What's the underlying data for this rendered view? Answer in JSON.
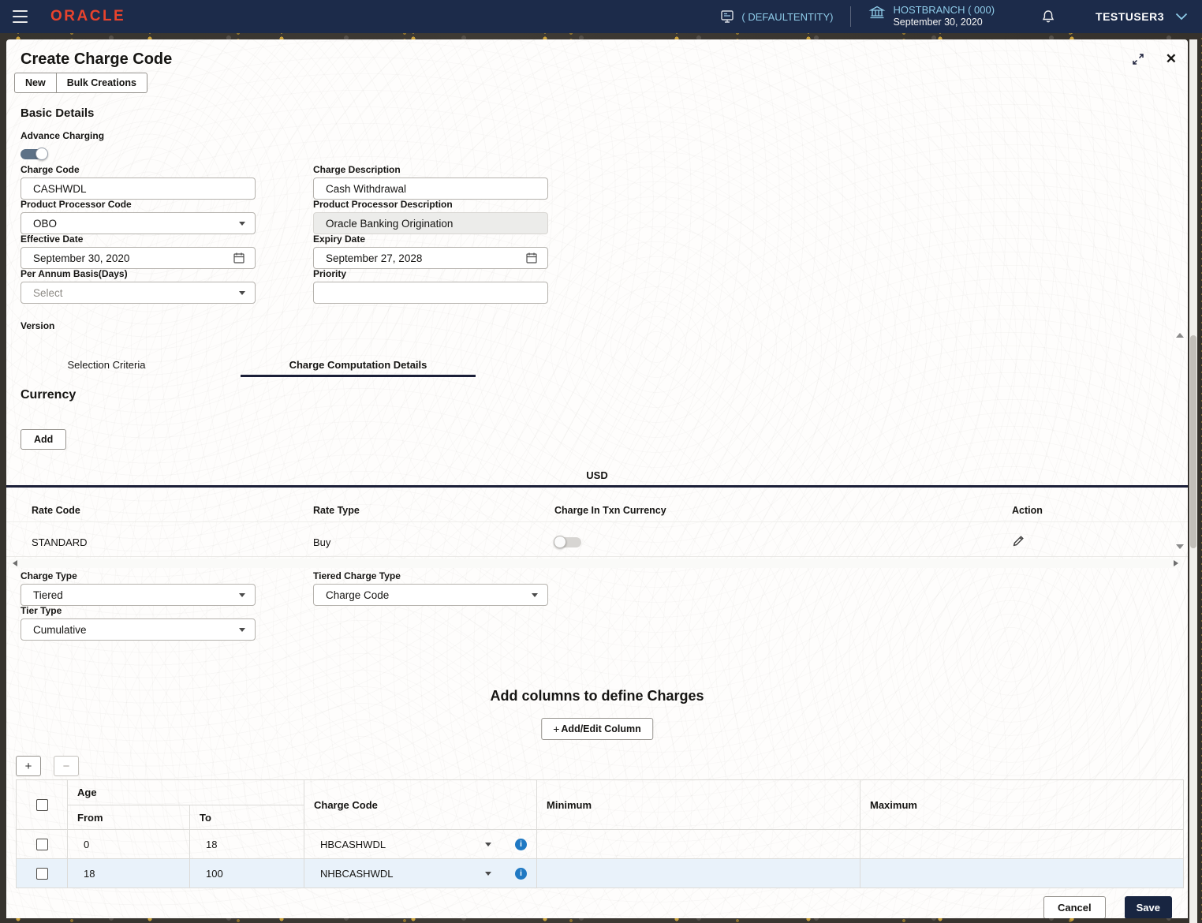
{
  "colors": {
    "header_bg": "#1c2b4a",
    "brand_red": "#e8432d",
    "header_link_blue": "#8ecbe8",
    "tab_underline": "#1b1f38",
    "row_highlight": "#e9f2fa",
    "info_blue": "#2079c3",
    "save_button_bg": "#182541"
  },
  "header": {
    "brand": "ORACLE",
    "entity_label": "( DEFAULTENTITY)",
    "branch_label": "HOSTBRANCH ( 000)",
    "branch_date": "September 30, 2020",
    "username": "TESTUSER3"
  },
  "panel": {
    "title": "Create Charge Code",
    "close_glyph": "✕"
  },
  "toolbar": {
    "new_label": "New",
    "bulk_label": "Bulk Creations"
  },
  "basic_details": {
    "heading": "Basic Details",
    "advance_charging_label": "Advance Charging",
    "charge_code_label": "Charge Code",
    "charge_code_value": "CASHWDL",
    "charge_description_label": "Charge Description",
    "charge_description_value": "Cash Withdrawal",
    "product_processor_code_label": "Product Processor Code",
    "product_processor_code_value": "OBO",
    "product_processor_description_label": "Product Processor Description",
    "product_processor_description_value": "Oracle Banking Origination",
    "effective_date_label": "Effective Date",
    "effective_date_value": "September 30, 2020",
    "expiry_date_label": "Expiry Date",
    "expiry_date_value": "September 27, 2028",
    "per_annum_label": "Per Annum Basis(Days)",
    "per_annum_value": "Select",
    "priority_label": "Priority",
    "priority_value": "",
    "version_label": "Version"
  },
  "tabs": {
    "selection_criteria": "Selection Criteria",
    "charge_computation": "Charge Computation Details"
  },
  "currency_section": {
    "heading": "Currency",
    "add_button": "Add",
    "currency_tab": "USD",
    "rate_table": {
      "headers": [
        "Rate Code",
        "Rate Type",
        "Charge In Txn Currency",
        "Action"
      ],
      "rows": [
        {
          "rate_code": "STANDARD",
          "rate_type": "Buy",
          "charge_in_txn_enabled": false
        }
      ]
    }
  },
  "charge_type_section": {
    "charge_type_label": "Charge Type",
    "charge_type_value": "Tiered",
    "tiered_charge_type_label": "Tiered Charge Type",
    "tiered_charge_type_value": "Charge Code",
    "tier_type_label": "Tier Type",
    "tier_type_value": "Cumulative"
  },
  "charges_section": {
    "heading": "Add columns to define Charges",
    "add_edit_column_label": "Add/Edit Column",
    "plus_glyph": "+",
    "minus_glyph": "−",
    "table": {
      "age_header": "Age",
      "from_header": "From",
      "to_header": "To",
      "charge_code_header": "Charge Code",
      "minimum_header": "Minimum",
      "maximum_header": "Maximum",
      "rows": [
        {
          "from": "0",
          "to": "18",
          "charge_code": "HBCASHWDL"
        },
        {
          "from": "18",
          "to": "100",
          "charge_code": "NHBCASHWDL"
        }
      ]
    }
  },
  "footer": {
    "cancel_label": "Cancel",
    "save_label": "Save"
  }
}
